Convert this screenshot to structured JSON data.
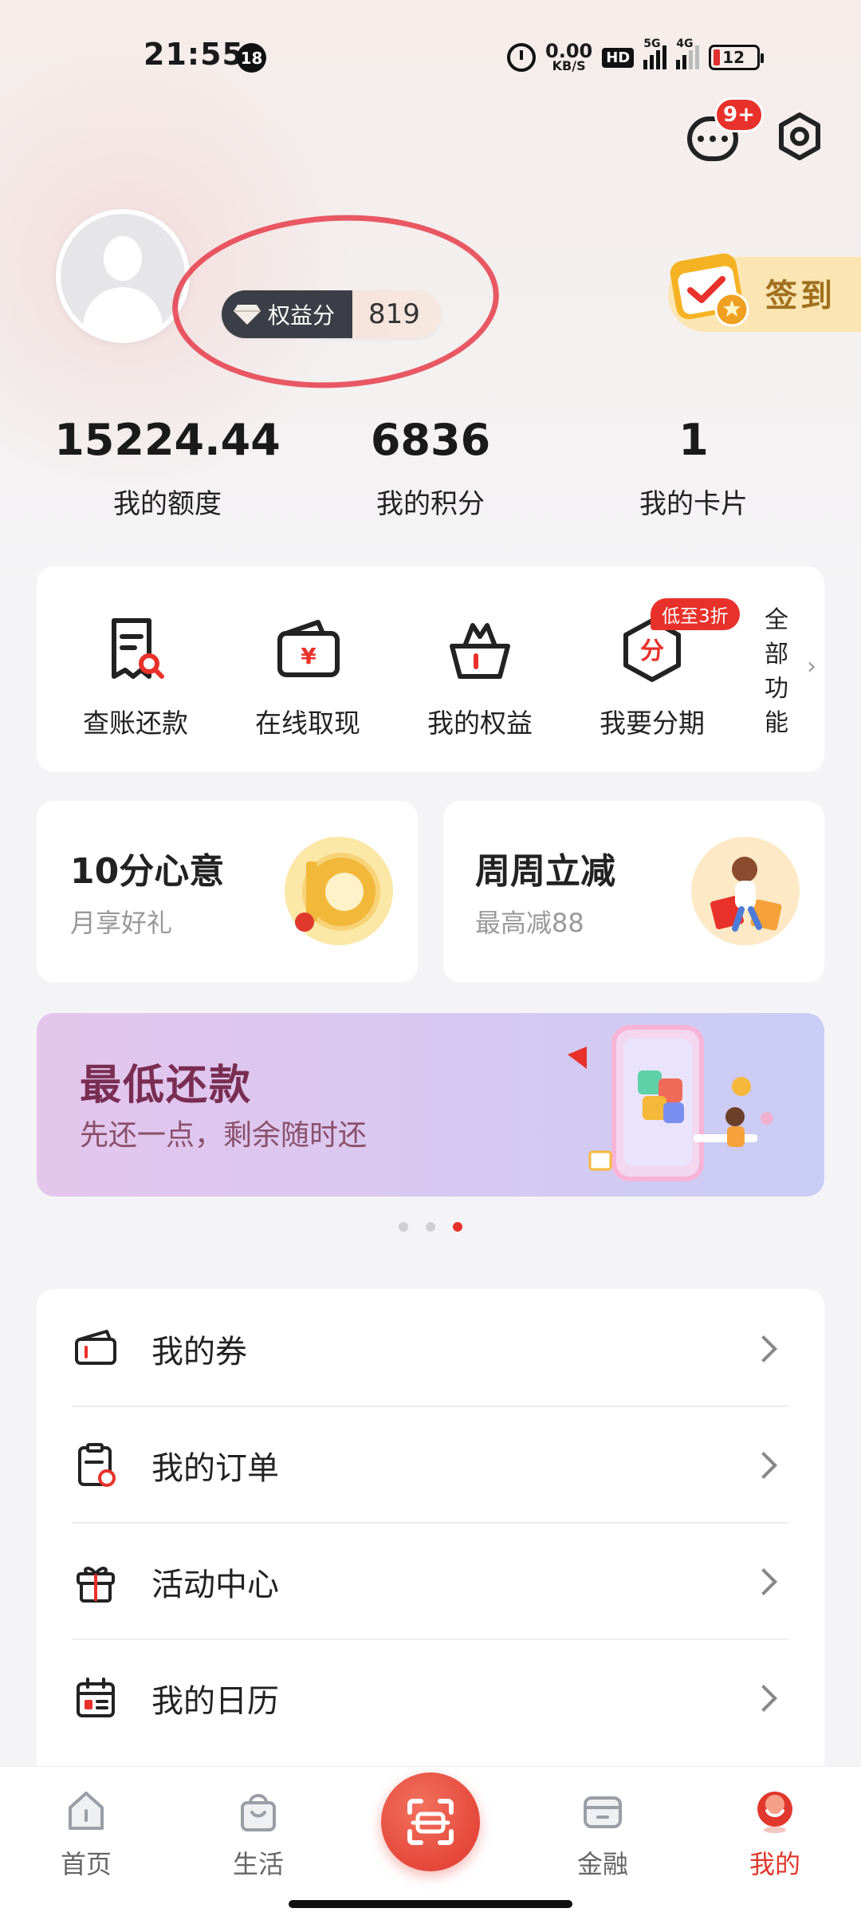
{
  "status_bar": {
    "time": "21:55",
    "notification_count": "18",
    "net_speed_value": "0.00",
    "net_speed_unit": "KB/S",
    "hd_label": "HD",
    "signal_5g": "5G",
    "signal_4g": "4G",
    "battery": "12"
  },
  "header": {
    "message_badge": "9+",
    "message_icon": "chat-bubble-icon",
    "settings_icon": "gear-icon"
  },
  "profile": {
    "rights_label": "权益分",
    "rights_value": "819",
    "signin_label": "签到"
  },
  "stats": [
    {
      "value": "15224.44",
      "label": "我的额度"
    },
    {
      "value": "6836",
      "label": "我的积分"
    },
    {
      "value": "1",
      "label": "我的卡片"
    }
  ],
  "quick_actions": {
    "items": [
      {
        "label": "查账还款",
        "icon": "bill-search-icon"
      },
      {
        "label": "在线取现",
        "icon": "wallet-yuan-icon"
      },
      {
        "label": "我的权益",
        "icon": "basket-icon"
      },
      {
        "label": "我要分期",
        "icon": "installment-icon"
      }
    ],
    "promo_tag": "低至3折",
    "installment_glyph": "分",
    "yuan_glyph": "¥",
    "all_label": "全部功能",
    "all_chars": [
      "全",
      "部",
      "功",
      "能"
    ],
    "all_arrow": "›"
  },
  "promo_cards": [
    {
      "title": "10分心意",
      "subtitle": "月享好礼"
    },
    {
      "title": "周周立减",
      "subtitle": "最高减88"
    }
  ],
  "banner": {
    "title": "最低还款",
    "subtitle": "先还一点，剩余随时还",
    "page_count": 3,
    "active_page": 3
  },
  "list": [
    {
      "label": "我的券",
      "icon": "coupon-icon"
    },
    {
      "label": "我的订单",
      "icon": "order-icon"
    },
    {
      "label": "活动中心",
      "icon": "gift-icon"
    },
    {
      "label": "我的日历",
      "icon": "calendar-icon"
    }
  ],
  "bottom_nav": {
    "items": [
      {
        "label": "首页",
        "icon": "home-icon",
        "active": false
      },
      {
        "label": "生活",
        "icon": "shopping-bag-icon",
        "active": false
      },
      {
        "label": "",
        "icon": "scan-icon",
        "active": false
      },
      {
        "label": "金融",
        "icon": "finance-card-icon",
        "active": false
      },
      {
        "label": "我的",
        "icon": "profile-icon",
        "active": true
      }
    ]
  },
  "colors": {
    "accent_red": "#e8312a",
    "active_nav": "#e0382d",
    "banner_title": "#7a2d52",
    "signin_text": "#a0701e"
  }
}
